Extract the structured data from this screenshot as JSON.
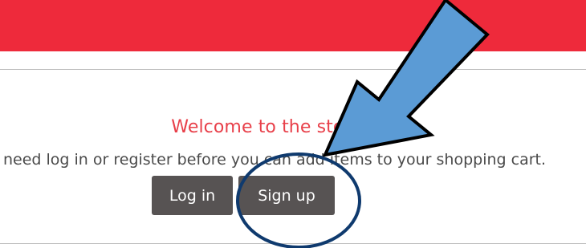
{
  "banner": {
    "color": "#ee2a3b"
  },
  "welcome": {
    "title": "Welcome to the store",
    "message": "need log in or register before you can add items to your shopping cart."
  },
  "buttons": {
    "login_label": "Log in",
    "signup_label": "Sign up"
  },
  "colors": {
    "title": "#e8404a",
    "button": "#575353",
    "arrow_fill": "#5b9bd5",
    "annotation_stroke": "#0f3a6e"
  },
  "annotations": {
    "arrow": "arrow-pointing-to-sign-up",
    "circle": "circle-highlighting-sign-up"
  }
}
